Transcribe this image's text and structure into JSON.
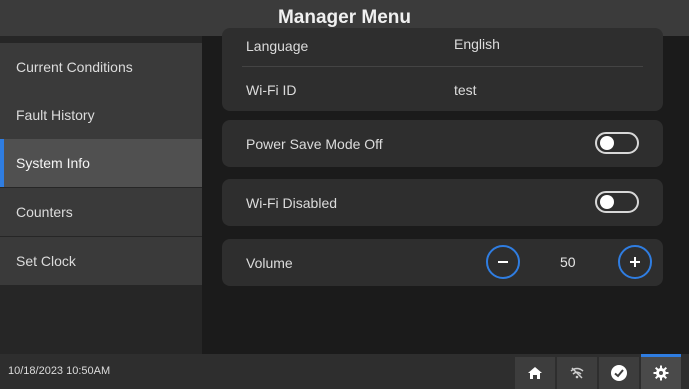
{
  "header": {
    "title": "Manager Menu"
  },
  "sidebar": {
    "items": [
      {
        "label": "Current Conditions"
      },
      {
        "label": "Fault History"
      },
      {
        "label": "System Info"
      },
      {
        "label": "Counters"
      },
      {
        "label": "Set Clock"
      }
    ],
    "active": "System Info"
  },
  "info": {
    "language_label": "Language",
    "language_value": "English",
    "wifi_id_label": "Wi-Fi ID",
    "wifi_id_value": "test"
  },
  "settings": {
    "power_save_label": "Power Save Mode Off",
    "power_save_on": false,
    "wifi_label": "Wi-Fi Disabled",
    "wifi_on": false,
    "volume_label": "Volume",
    "volume_value": "50"
  },
  "status": {
    "datetime": "10/18/2023 10:50AM",
    "icons": [
      "home-icon",
      "wifi-off-icon",
      "check-circle-icon",
      "gear-icon"
    ],
    "active_icon": "gear-icon"
  },
  "colors": {
    "accent": "#2f7de1",
    "background": "#1e1e1e",
    "card": "#2e2e2e"
  }
}
